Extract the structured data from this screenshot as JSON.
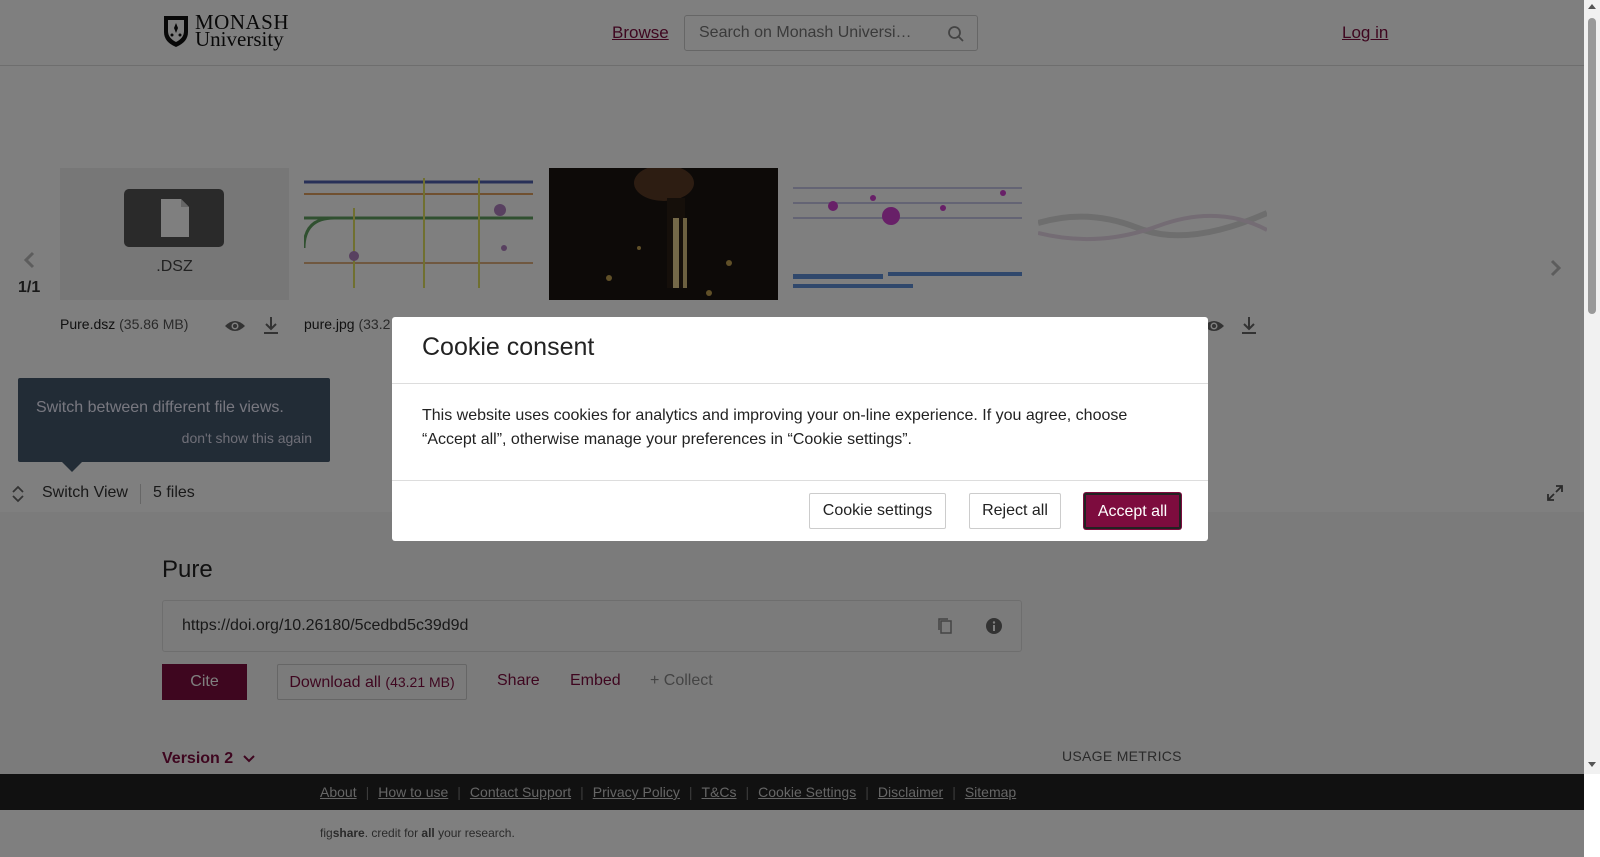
{
  "header": {
    "logo_line1": "MONASH",
    "logo_line2": "University",
    "browse": "Browse",
    "search_placeholder": "Search on Monash Universi…",
    "login": "Log in"
  },
  "viewer": {
    "counter": "1/1",
    "files": [
      {
        "name": "Pure.dsz",
        "size": "(35.86 MB)",
        "type_label": ".DSZ"
      },
      {
        "name": "pure.jpg",
        "size": "(33.2"
      }
    ],
    "tooltip_text": "Switch between different file views.",
    "tooltip_dismiss": "don't show this again",
    "switch_view": "Switch View",
    "files_count": "5 files"
  },
  "item": {
    "title": "Pure",
    "doi": "https://doi.org/10.26180/5cedbd5c39d9d",
    "cite": "Cite",
    "download_all": "Download all",
    "download_size": "(43.21 MB)",
    "share": "Share",
    "embed": "Embed",
    "collect": "+ Collect",
    "version": "Version 2",
    "usage_metrics": "USAGE METRICS"
  },
  "footer": {
    "links": [
      "About",
      "How to use",
      "Contact Support",
      "Privacy Policy",
      "T&Cs",
      "Cookie Settings",
      "Disclaimer",
      "Sitemap"
    ],
    "credit_prefix": "fig",
    "credit_bold1": "share",
    "credit_mid": ". credit for ",
    "credit_bold2": "all",
    "credit_suffix": " your research."
  },
  "cookie_modal": {
    "title": "Cookie consent",
    "body": "This website uses cookies for analytics and improving your on-line experience. If you agree, choose “Accept all”, otherwise manage your preferences in “Cookie settings”.",
    "settings_button": "Cookie settings",
    "reject_button": "Reject all",
    "accept_button": "Accept all"
  },
  "colors": {
    "brand": "#7d0c3e",
    "overlay": "rgba(0,0,0,0.5)"
  }
}
